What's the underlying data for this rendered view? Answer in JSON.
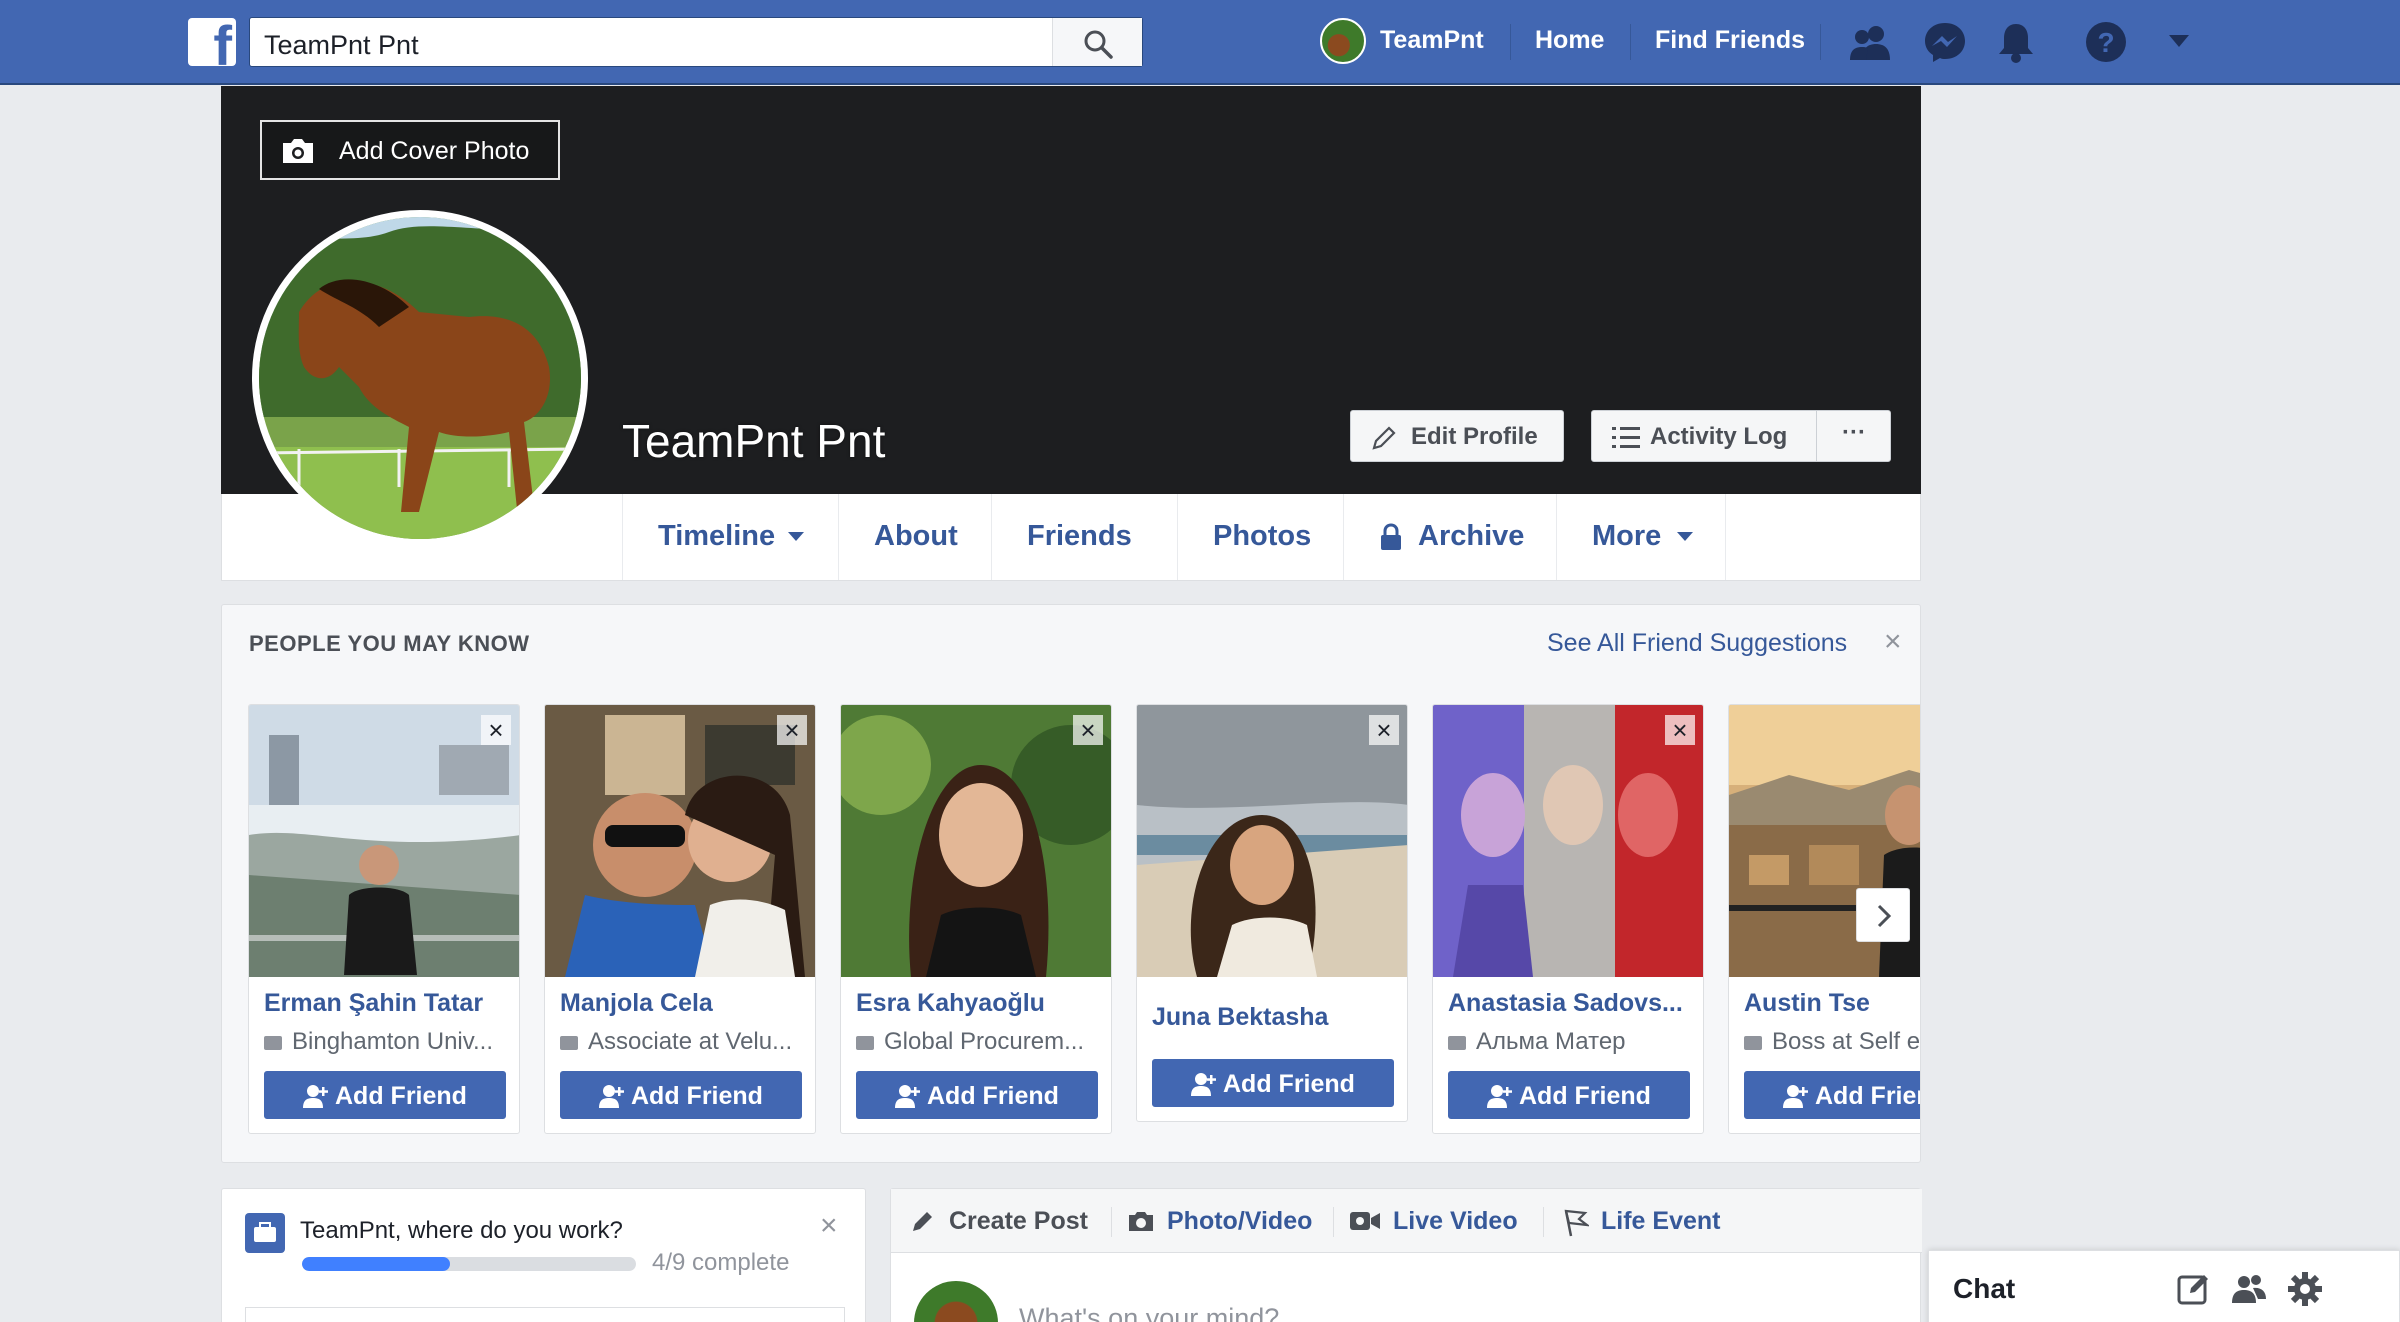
{
  "topbar": {
    "logo_icon": "facebook-logo-icon",
    "search_value": "TeamPnt Pnt",
    "search_icon": "search-icon",
    "profile_name": "TeamPnt",
    "links": [
      "Home",
      "Find Friends"
    ],
    "icons": [
      "friend-requests-icon",
      "messenger-icon",
      "notifications-icon",
      "help-icon",
      "account-menu-chevron-icon"
    ],
    "brand_color": "#4267b2"
  },
  "cover": {
    "add_cover_label": "Add Cover Photo",
    "name": "TeamPnt Pnt",
    "edit_profile_label": "Edit Profile",
    "activity_log_label": "Activity Log",
    "more_label": "···"
  },
  "tabs": [
    {
      "label": "Timeline",
      "dropdown": true
    },
    {
      "label": "About"
    },
    {
      "label": "Friends"
    },
    {
      "label": "Photos"
    },
    {
      "label": "Archive",
      "icon": "lock-icon"
    },
    {
      "label": "More",
      "dropdown": true
    }
  ],
  "pymk": {
    "heading": "PEOPLE YOU MAY KNOW",
    "see_all": "See All Friend Suggestions",
    "close": "×",
    "dismiss": "×",
    "add_label": "Add Friend",
    "people": [
      {
        "name": "Erman Şahin Tatar",
        "subtitle": "Binghamton Univ...",
        "sub_icon": "school-icon"
      },
      {
        "name": "Manjola Cela",
        "subtitle": "Associate at Velu...",
        "sub_icon": "work-icon"
      },
      {
        "name": "Esra Kahyaoğlu",
        "subtitle": "Global Procurem...",
        "sub_icon": "work-icon"
      },
      {
        "name": "Juna Bektasha",
        "subtitle": "",
        "sub_icon": ""
      },
      {
        "name": "Anastasia Sadovs...",
        "subtitle": "Альма Матер",
        "sub_icon": "school-icon"
      },
      {
        "name": "Austin Tse",
        "subtitle": "Boss at Self e",
        "sub_icon": "work-icon"
      }
    ]
  },
  "work_prompt": {
    "question": "TeamPnt, where do you work?",
    "progress": "4/9 complete",
    "progress_fraction": 0.444,
    "close": "×"
  },
  "composer": {
    "tabs": [
      "Create Post",
      "Photo/Video",
      "Live Video",
      "Life Event"
    ],
    "placeholder": "What's on your mind?"
  },
  "chat": {
    "title": "Chat",
    "icons": [
      "compose-icon",
      "new-group-icon",
      "settings-gear-icon"
    ]
  }
}
